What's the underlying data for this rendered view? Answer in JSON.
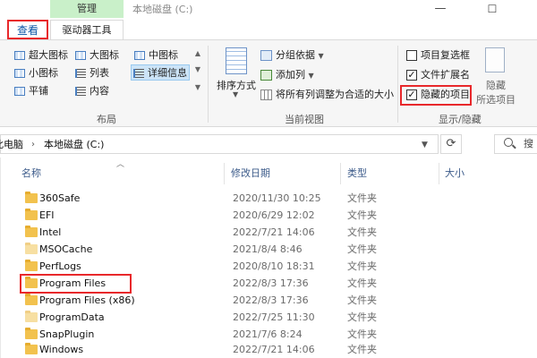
{
  "window": {
    "manage_tab": "管理",
    "title": "本地磁盘 (C:)",
    "minimize": "—",
    "maximize": "☐"
  },
  "tabs": {
    "view": "查看",
    "drive_tools": "驱动器工具"
  },
  "ribbon": {
    "layout": {
      "group_label": "布局",
      "items": [
        {
          "label": "超大图标",
          "icon": "extra-large-icons-icon",
          "selected": false
        },
        {
          "label": "大图标",
          "icon": "large-icons-icon",
          "selected": false
        },
        {
          "label": "中图标",
          "icon": "medium-icons-icon",
          "selected": false
        },
        {
          "label": "小图标",
          "icon": "small-icons-icon",
          "selected": false
        },
        {
          "label": "列表",
          "icon": "list-icon",
          "selected": false
        },
        {
          "label": "详细信息",
          "icon": "details-icon",
          "selected": true
        },
        {
          "label": "平铺",
          "icon": "tiles-icon",
          "selected": false
        },
        {
          "label": "内容",
          "icon": "content-icon",
          "selected": false
        }
      ]
    },
    "current_view": {
      "group_label": "当前视图",
      "sort_by": "排序方式",
      "group_by": "分组依据",
      "add_column": "添加列",
      "fit_columns": "将所有列调整为合适的大小"
    },
    "show_hide": {
      "group_label": "显示/隐藏",
      "item_checkboxes": {
        "label": "项目复选框",
        "checked": false
      },
      "file_extensions": {
        "label": "文件扩展名",
        "checked": true
      },
      "hidden_items": {
        "label": "隐藏的项目",
        "checked": true
      },
      "hide_selected_line1": "隐藏",
      "hide_selected_line2": "所选项目"
    }
  },
  "address": {
    "path": [
      "此电脑",
      "本地磁盘 (C:)"
    ],
    "separator": "›",
    "search_placeholder": "搜"
  },
  "file_list": {
    "columns": {
      "name": "名称",
      "modified": "修改日期",
      "type": "类型",
      "size": "大小"
    },
    "highlight_color": "#e8282b",
    "rows": [
      {
        "name": "360Safe",
        "date": "2020/11/30 10:25",
        "type": "文件夹",
        "hidden": false
      },
      {
        "name": "EFI",
        "date": "2020/6/29 12:02",
        "type": "文件夹",
        "hidden": false
      },
      {
        "name": "Intel",
        "date": "2022/7/21 14:06",
        "type": "文件夹",
        "hidden": false
      },
      {
        "name": "MSOCache",
        "date": "2021/8/4 8:46",
        "type": "文件夹",
        "hidden": true
      },
      {
        "name": "PerfLogs",
        "date": "2020/8/10 18:31",
        "type": "文件夹",
        "hidden": false
      },
      {
        "name": "Program Files",
        "date": "2022/8/3 17:36",
        "type": "文件夹",
        "hidden": false
      },
      {
        "name": "Program Files (x86)",
        "date": "2022/8/3 17:36",
        "type": "文件夹",
        "hidden": false
      },
      {
        "name": "ProgramData",
        "date": "2022/7/25 11:30",
        "type": "文件夹",
        "hidden": true
      },
      {
        "name": "SnapPlugin",
        "date": "2021/7/6 8:24",
        "type": "文件夹",
        "hidden": false
      },
      {
        "name": "Windows",
        "date": "2022/7/21 14:06",
        "type": "文件夹",
        "hidden": false
      }
    ]
  }
}
